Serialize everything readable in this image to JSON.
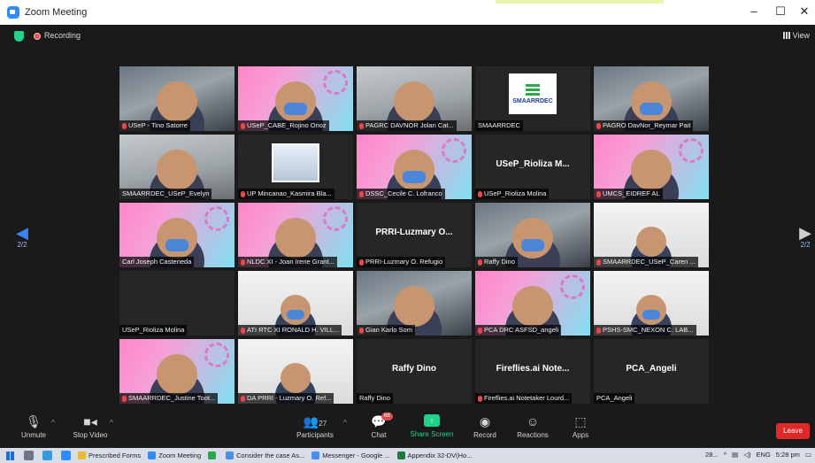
{
  "window": {
    "title": "Zoom Meeting",
    "controls": [
      "–",
      "☐",
      "✕"
    ]
  },
  "topbar": {
    "recording_label": "Recording",
    "view_label": "View"
  },
  "navigation": {
    "left_page": "2/2",
    "right_page": "2/2"
  },
  "tiles": [
    {
      "style": "cam",
      "name": "USeP - Tino Satorre",
      "muted": true
    },
    {
      "style": "pink",
      "name": "USeP_CABE_Rojino Orioz",
      "muted": true
    },
    {
      "style": "office",
      "name": "PAGRC DAVNOR Jolan Cat...",
      "muted": true
    },
    {
      "style": "sma",
      "name": "SMAARRDEC",
      "muted": false,
      "logo_text": "SMAARRDEC"
    },
    {
      "style": "cam",
      "name": "PAGRO DavNor_Reymar Pait",
      "muted": true
    },
    {
      "style": "office",
      "name": "SMAARRDEC_USeP_Evelyn",
      "muted": false
    },
    {
      "style": "photo",
      "name": "UP Mincanao_Kasmira Bla...",
      "muted": true
    },
    {
      "style": "pink",
      "name": "DSSC_Cecile C. Lofranco",
      "muted": true
    },
    {
      "style": "text",
      "name": "USeP_Rioliza Molina",
      "muted": true,
      "center": "USeP_Rioliza  M..."
    },
    {
      "style": "pink",
      "name": "UMCS_EIDREF AL",
      "muted": true
    },
    {
      "style": "pink",
      "name": "Carl Joseph Casteneda",
      "muted": false
    },
    {
      "style": "pink",
      "name": "NLDC XI - Joan Irene Grant...",
      "muted": true
    },
    {
      "style": "text",
      "name": "PRRI-Luzmary O. Refugio",
      "muted": true,
      "center": "PRRI-Luzmary O..."
    },
    {
      "style": "cam",
      "name": "Raffy Dino",
      "muted": true
    },
    {
      "style": "white",
      "name": "SMAARRDEC_USeP_Caren ...",
      "muted": true
    },
    {
      "style": "text",
      "name": "USeP_Rioliza Molina",
      "muted": false,
      "center": ""
    },
    {
      "style": "white",
      "name": "ATI RTC XI RONALD H. VILL...",
      "muted": true
    },
    {
      "style": "cam",
      "name": "Gian Karlo Som",
      "muted": true
    },
    {
      "style": "pink",
      "name": "PCA DRC ASFSD_angeli",
      "muted": true
    },
    {
      "style": "white",
      "name": "PSHS-SMC_NEXON C. LAB...",
      "muted": true
    },
    {
      "style": "pink",
      "name": "SMAARRDEC_Justine Toot...",
      "muted": true
    },
    {
      "style": "white",
      "name": "DA PRRI - Luzmary O. Ref...",
      "muted": true
    },
    {
      "style": "text",
      "name": "Raffy Dino",
      "muted": false,
      "center": "Raffy Dino"
    },
    {
      "style": "text",
      "name": "Fireflies.ai Notetaker Lourd...",
      "muted": true,
      "center": "Fireflies.ai  Note..."
    },
    {
      "style": "text",
      "name": "PCA_Angeli",
      "muted": false,
      "center": "PCA_Angeli"
    }
  ],
  "toolbar": {
    "unmute": "Unmute",
    "stop_video": "Stop Video",
    "participants": "Participants",
    "participants_count": "27",
    "chat": "Chat",
    "chat_badge": "68",
    "share_screen": "Share Screen",
    "record": "Record",
    "reactions": "Reactions",
    "apps": "Apps",
    "leave": "Leave"
  },
  "taskbar": {
    "apps": [
      {
        "label": "Prescribed Forms",
        "color": "#e8b838"
      },
      {
        "label": "Zoom Meeting",
        "color": "#2d8cff"
      },
      {
        "label": "",
        "color": "#2aa84a"
      },
      {
        "label": "Consider the case As...",
        "color": "#4a8fe8"
      },
      {
        "label": "Messenger - Google ...",
        "color": "#4a8fe8"
      },
      {
        "label": "Appendix 32-DV(Ho...",
        "color": "#1e7a3c"
      }
    ],
    "tray": {
      "temp": "28...",
      "lang": "ENG",
      "time": "5:28 pm"
    }
  }
}
